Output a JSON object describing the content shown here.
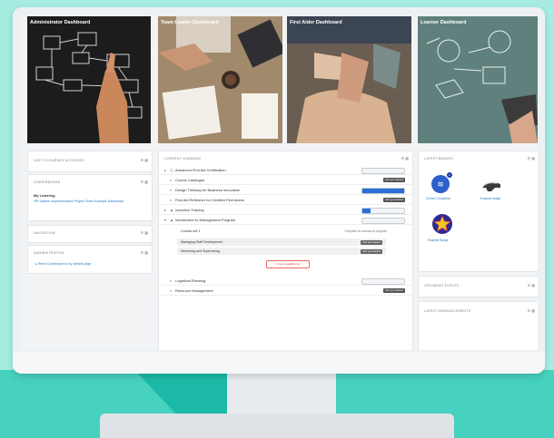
{
  "dashboards": [
    {
      "title": "Administrator Dashboard"
    },
    {
      "title": "Team Leader Dashboard"
    },
    {
      "title": "First Aider Dashboard"
    },
    {
      "title": "Learner Dashboard"
    }
  ],
  "left": {
    "last_courses_header": "LAST 5 COURSES ACCESSED",
    "leaderboard_header": "LEADERBOARD",
    "my_learning_title": "My Learning",
    "my_learning_link": "HR System Implementation Project Team Example Dashboard",
    "navigation_header": "NAVIGATION",
    "administration_header": "ADMINISTRATION",
    "admin_link": "Reset Dashboard to my default page"
  },
  "center": {
    "header": "CURRENT LEARNING",
    "rows": [
      {
        "label": "Advanced First Aid Certification",
        "kind": "progress",
        "percent": 0
      },
      {
        "label": "Course Catalogue",
        "kind": "badge",
        "badge": "Not yet started"
      },
      {
        "label": "Design Thinking for Business Innovation",
        "kind": "progress",
        "percent": 100
      },
      {
        "label": "First Aid Refresher for Certified First Aiders",
        "kind": "badge",
        "badge": "Not yet started"
      },
      {
        "label": "Induction Training",
        "kind": "progress",
        "percent": 20
      },
      {
        "label": "Introduction to Management Program",
        "kind": "progress",
        "percent": 0
      }
    ],
    "course_set_title": "Course set 1",
    "course_set_note": "Complete all courses to progress",
    "sub_rows": [
      {
        "label": "Managing Staff Development",
        "badge": "Not yet started"
      },
      {
        "label": "Mentoring and Supervising",
        "badge": "Not yet started"
      }
    ],
    "more_button": "1 more available set",
    "bottom_rows": [
      {
        "label": "Logistical Planning",
        "kind": "progress",
        "percent": 0
      },
      {
        "label": "Resource Management",
        "kind": "badge",
        "badge": "Not yet started"
      }
    ]
  },
  "right": {
    "badges_header": "LATEST BADGES",
    "badges": [
      {
        "name": "Course Completion",
        "color": "#2b5fc9"
      },
      {
        "name": "Example badge",
        "color": "#3b3b3b"
      },
      {
        "name": "Example Badge",
        "color": "#2e2a8e"
      }
    ],
    "upcoming_header": "UPCOMING EVENTS",
    "announcements_header": "LATEST ANNOUNCEMENTS"
  },
  "controls": "⚙ ▦"
}
